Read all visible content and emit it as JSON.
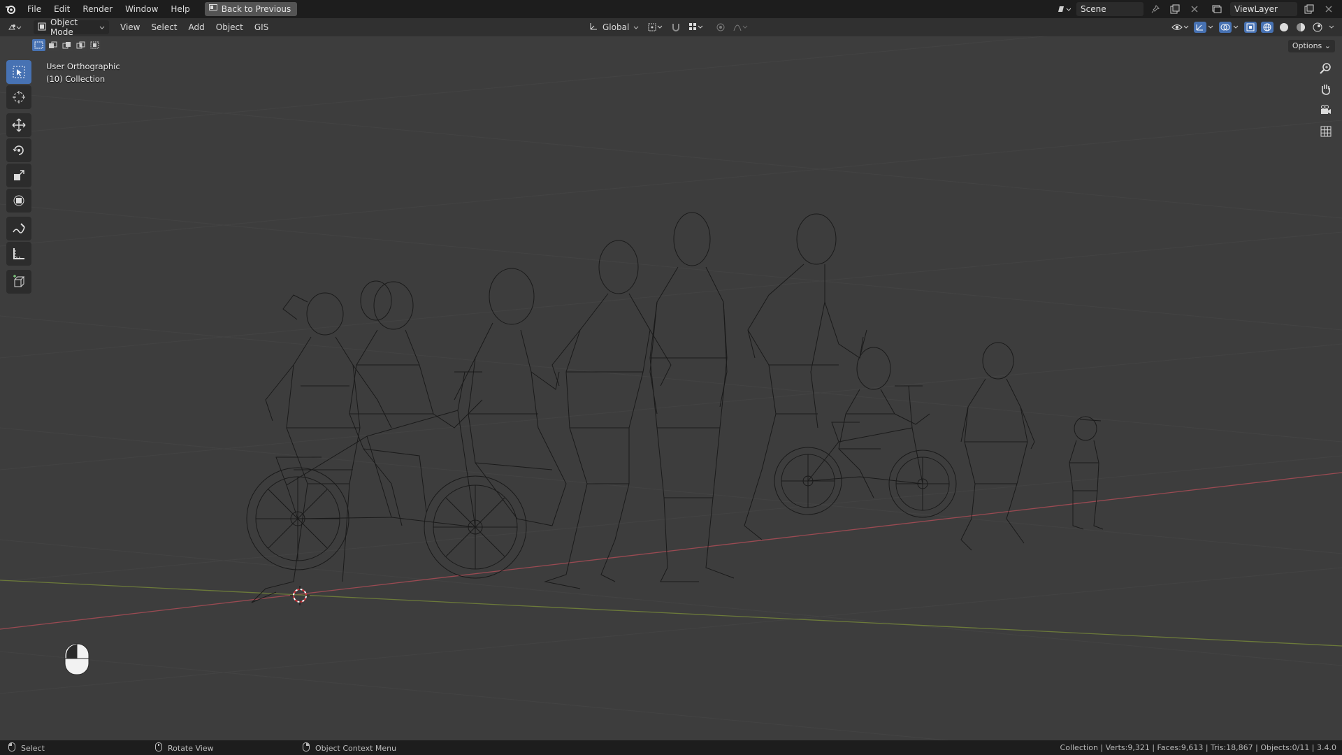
{
  "topbar": {
    "menus": [
      "File",
      "Edit",
      "Render",
      "Window",
      "Help"
    ],
    "back_button": "Back to Previous",
    "scene_name": "Scene",
    "view_layer": "ViewLayer"
  },
  "viewport_header": {
    "mode": "Object Mode",
    "menus": [
      "View",
      "Select",
      "Add",
      "Object",
      "GIS"
    ],
    "transform_orientation": "Global",
    "options_label": "Options"
  },
  "viewport": {
    "view_name": "User Orthographic",
    "collection_label": "(10) Collection"
  },
  "statusbar": {
    "select_hint": "Select",
    "rotate_hint": "Rotate View",
    "context_hint": "Object Context Menu",
    "stats": "Collection | Verts:9,321 | Faces:9,613 | Tris:18,867 | Objects:0/11 | 3.4.0"
  },
  "colors": {
    "accent": "#4772b3",
    "x_axis": "#9a4a52",
    "y_axis": "#6c7a3a",
    "wire": "#161616"
  },
  "icons": {
    "logo": "blender-logo-icon",
    "tools": [
      "select-box-icon",
      "cursor-icon",
      "move-icon",
      "rotate-icon",
      "scale-icon",
      "transform-icon",
      "annotate-icon",
      "measure-icon",
      "add-cube-icon"
    ],
    "nav": [
      "zoom-icon",
      "pan-hand-icon",
      "camera-icon",
      "grid-toggle-icon"
    ]
  }
}
